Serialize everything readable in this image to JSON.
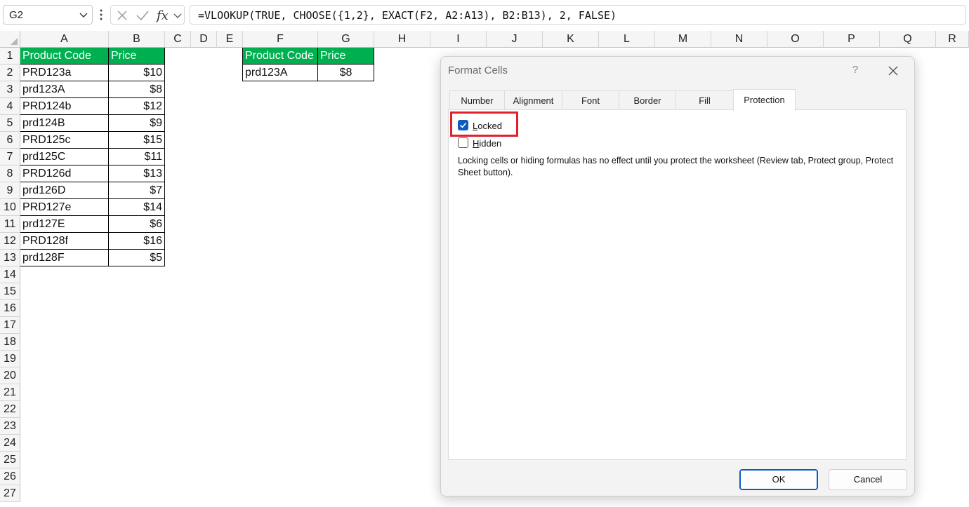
{
  "formula_bar": {
    "name_box": "G2",
    "formula": "=VLOOKUP(TRUE, CHOOSE({1,2}, EXACT(F2, A2:A13), B2:B13), 2, FALSE)",
    "icons": [
      "cancel-x-icon",
      "confirm-check-icon",
      "fx-icon",
      "chevron-down-icon"
    ]
  },
  "columns": [
    "A",
    "B",
    "C",
    "D",
    "E",
    "F",
    "G",
    "H",
    "I",
    "J",
    "K",
    "L",
    "M",
    "N",
    "O",
    "P",
    "Q",
    "R"
  ],
  "rows": [
    "1",
    "2",
    "3",
    "4",
    "5",
    "6",
    "7",
    "8",
    "9",
    "10",
    "11",
    "12",
    "13",
    "14",
    "15",
    "16",
    "17",
    "18",
    "19",
    "20",
    "21",
    "22",
    "23",
    "24",
    "25",
    "26",
    "27"
  ],
  "table1": {
    "headers": [
      "Product Code",
      "Price"
    ],
    "rows": [
      [
        "PRD123a",
        "$10"
      ],
      [
        "prd123A",
        "$8"
      ],
      [
        "PRD124b",
        "$12"
      ],
      [
        "prd124B",
        "$9"
      ],
      [
        "PRD125c",
        "$15"
      ],
      [
        "prd125C",
        "$11"
      ],
      [
        "PRD126d",
        "$13"
      ],
      [
        "prd126D",
        "$7"
      ],
      [
        "PRD127e",
        "$14"
      ],
      [
        "prd127E",
        "$6"
      ],
      [
        "PRD128f",
        "$16"
      ],
      [
        "prd128F",
        "$5"
      ]
    ]
  },
  "table2": {
    "headers": [
      "Product Code",
      "Price"
    ],
    "rows": [
      [
        "prd123A",
        "$8"
      ]
    ]
  },
  "dialog": {
    "title": "Format Cells",
    "help": "?",
    "tabs": [
      "Number",
      "Alignment",
      "Font",
      "Border",
      "Fill",
      "Protection"
    ],
    "active_tab": "Protection",
    "locked_label_first": "L",
    "locked_label_rest": "ocked",
    "locked_checked": true,
    "hidden_label_first": "H",
    "hidden_label_rest": "idden",
    "hidden_checked": false,
    "note": "Locking cells or hiding formulas has no effect until you protect the worksheet (Review tab, Protect group, Protect Sheet button).",
    "ok_label": "OK",
    "cancel_label": "Cancel",
    "highlight_color": "#e0202a",
    "accent_color": "#0f5cbf"
  },
  "colors": {
    "header_fill": "#00b050",
    "header_text": "#ffffff"
  }
}
